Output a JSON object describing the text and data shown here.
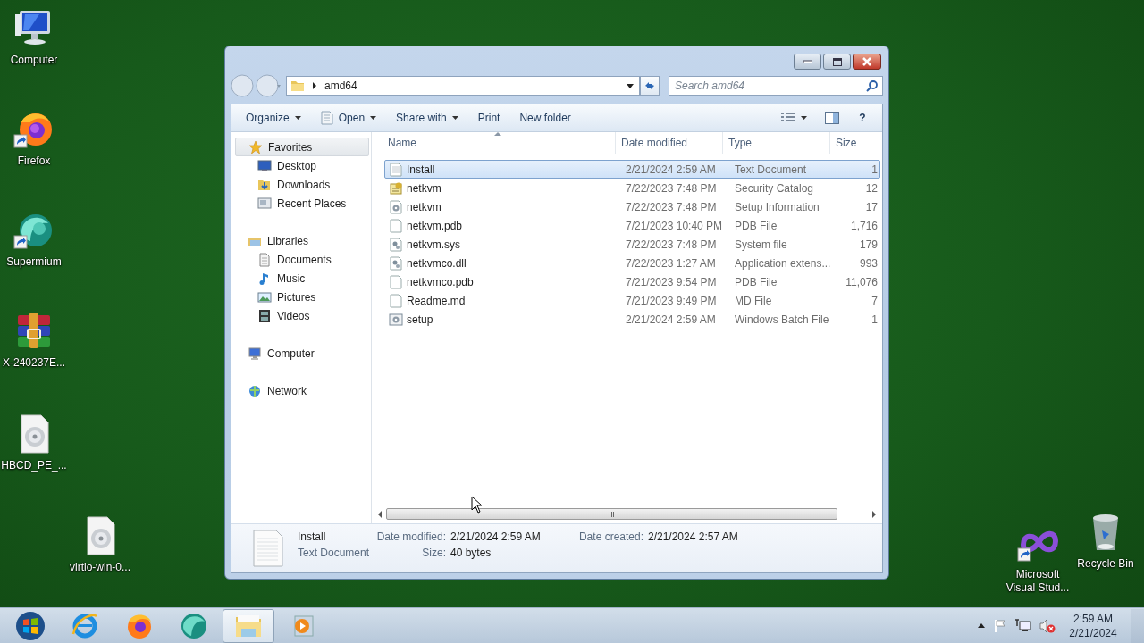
{
  "desktop_icons": [
    {
      "label": "Computer",
      "kind": "computer",
      "shortcut": false
    },
    {
      "label": "Firefox",
      "kind": "firefox",
      "shortcut": true
    },
    {
      "label": "Supermium",
      "kind": "supermium",
      "shortcut": true
    },
    {
      "label": "X-240237E...",
      "kind": "archive",
      "shortcut": false
    },
    {
      "label": "HBCD_PE_...",
      "kind": "disc",
      "shortcut": false
    },
    {
      "label": "virtio-win-0...",
      "kind": "disc",
      "shortcut": false
    },
    {
      "label": "Microsoft Visual Stud...",
      "kind": "vs",
      "shortcut": true
    },
    {
      "label": "Recycle Bin",
      "kind": "recycle",
      "shortcut": false
    }
  ],
  "window": {
    "address": {
      "path": "amd64"
    },
    "search": {
      "placeholder": "Search amd64"
    },
    "toolbar": [
      {
        "label": "Organize",
        "kind": "menu"
      },
      {
        "label": "Open",
        "kind": "open"
      },
      {
        "label": "Share with",
        "kind": "menu"
      },
      {
        "label": "Print",
        "kind": "plain"
      },
      {
        "label": "New folder",
        "kind": "plain"
      }
    ],
    "navigation": [
      {
        "label": "Favorites",
        "kind": "star",
        "selected": true,
        "children": [
          {
            "label": "Desktop",
            "kind": "desktop"
          },
          {
            "label": "Downloads",
            "kind": "downloads"
          },
          {
            "label": "Recent Places",
            "kind": "recent"
          }
        ]
      },
      {
        "label": "Libraries",
        "kind": "library",
        "selected": false,
        "children": [
          {
            "label": "Documents",
            "kind": "documents"
          },
          {
            "label": "Music",
            "kind": "music"
          },
          {
            "label": "Pictures",
            "kind": "pictures"
          },
          {
            "label": "Videos",
            "kind": "videos"
          }
        ]
      },
      {
        "label": "Computer",
        "kind": "computer",
        "selected": false
      },
      {
        "label": "Network",
        "kind": "network",
        "selected": false
      }
    ],
    "help": "?",
    "columns": [
      "Name",
      "Date modified",
      "Type",
      "Size"
    ],
    "files": [
      {
        "name": "Install",
        "date": "2/21/2024 2:59 AM",
        "type": "Text Document",
        "size": "1",
        "kind": "text",
        "selected": true
      },
      {
        "name": "netkvm",
        "date": "7/22/2023 7:48 PM",
        "type": "Security Catalog",
        "size": "12",
        "kind": "catalog",
        "selected": false
      },
      {
        "name": "netkvm",
        "date": "7/22/2023 7:48 PM",
        "type": "Setup Information",
        "size": "17",
        "kind": "setup",
        "selected": false
      },
      {
        "name": "netkvm.pdb",
        "date": "7/21/2023 10:40 PM",
        "type": "PDB File",
        "size": "1,716",
        "kind": "blank",
        "selected": false
      },
      {
        "name": "netkvm.sys",
        "date": "7/22/2023 7:48 PM",
        "type": "System file",
        "size": "179",
        "kind": "system",
        "selected": false
      },
      {
        "name": "netkvmco.dll",
        "date": "7/22/2023 1:27 AM",
        "type": "Application extens...",
        "size": "993",
        "kind": "system",
        "selected": false
      },
      {
        "name": "netkvmco.pdb",
        "date": "7/21/2023 9:54 PM",
        "type": "PDB File",
        "size": "11,076",
        "kind": "blank",
        "selected": false
      },
      {
        "name": "Readme.md",
        "date": "7/21/2023 9:49 PM",
        "type": "MD File",
        "size": "7",
        "kind": "blank",
        "selected": false
      },
      {
        "name": "setup",
        "date": "2/21/2024 2:59 AM",
        "type": "Windows Batch File",
        "size": "1",
        "kind": "batch",
        "selected": false
      }
    ],
    "details": {
      "name": "Install",
      "type": "Text Document",
      "fields": [
        {
          "label": "Date modified:",
          "value": "2/21/2024 2:59 AM"
        },
        {
          "label": "Date created:",
          "value": "2/21/2024 2:57 AM"
        },
        {
          "label": "Size:",
          "value": "40 bytes"
        }
      ]
    }
  },
  "taskbar": {
    "items": [
      {
        "kind": "start",
        "selected": false
      },
      {
        "kind": "ie",
        "selected": false
      },
      {
        "kind": "firefox",
        "selected": false
      },
      {
        "kind": "supermium",
        "selected": false
      },
      {
        "kind": "explorer",
        "selected": true
      },
      {
        "kind": "media",
        "selected": false
      }
    ],
    "clock": {
      "time": "2:59 AM",
      "date": "2/21/2024"
    }
  }
}
